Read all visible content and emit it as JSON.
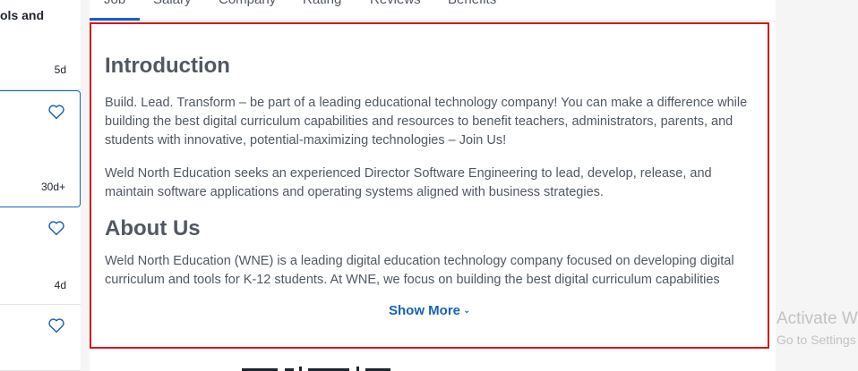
{
  "job_list": {
    "cards": [
      {
        "partial_title": "ols and",
        "age": "5d"
      },
      {
        "partial_title": "",
        "age": "30d+"
      },
      {
        "partial_title": "",
        "age": "4d"
      },
      {
        "partial_title": "",
        "age": ""
      }
    ]
  },
  "tabs": [
    {
      "label": "Job"
    },
    {
      "label": "Salary"
    },
    {
      "label": "Company"
    },
    {
      "label": "Rating"
    },
    {
      "label": "Reviews"
    },
    {
      "label": "Benefits"
    }
  ],
  "description": {
    "heading_intro": "Introduction",
    "para_1": "Build. Lead. Transform – be part of a leading educational technology company! You can make a difference while building the best digital curriculum capabilities and resources to benefit teachers, administrators, parents, and students with innovative, potential-maximizing technologies – Join Us!",
    "para_2": "Weld North Education seeks an experienced Director Software Engineering to lead, develop, release, and maintain software applications and operating systems aligned with business strategies.",
    "heading_about": "About Us",
    "para_3": "Weld North Education (WNE) is a leading digital education technology company focused on developing digital curriculum and tools for K-12 students. At WNE, we focus on building the best digital curriculum capabilities",
    "show_more": "Show More"
  },
  "watermark": {
    "line_1": "Activate W",
    "line_2": "Go to Settings"
  },
  "colors": {
    "accent": "#1861bf",
    "highlight_border": "#d6161c",
    "text": "#505863"
  }
}
